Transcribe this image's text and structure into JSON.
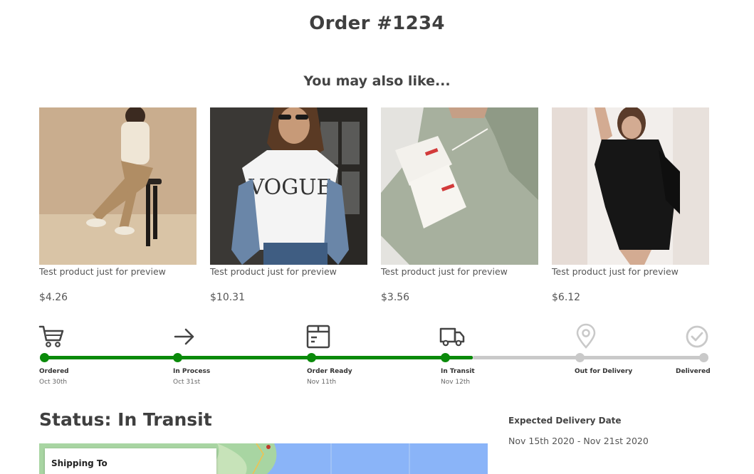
{
  "order": {
    "title": "Order #1234"
  },
  "recommendations": {
    "title": "You may also like...",
    "products": [
      {
        "name": "Test product just for preview",
        "price": "$4.26"
      },
      {
        "name": "Test product just for preview",
        "price": "$10.31"
      },
      {
        "name": "Test product just for preview",
        "price": "$3.56"
      },
      {
        "name": "Test product just for preview",
        "price": "$6.12"
      }
    ]
  },
  "tracking": {
    "progress_color": "#0a8a0a",
    "pending_color": "#c9c9c9",
    "steps": [
      {
        "label": "Ordered",
        "date": "Oct 30th",
        "icon": "cart-icon",
        "done": true
      },
      {
        "label": "In Process",
        "date": "Oct 31st",
        "icon": "arrow-right-icon",
        "done": true
      },
      {
        "label": "Order Ready",
        "date": "Nov 11th",
        "icon": "package-icon",
        "done": true
      },
      {
        "label": "In Transit",
        "date": "Nov 12th",
        "icon": "truck-icon",
        "done": true
      },
      {
        "label": "Out for Delivery",
        "date": "",
        "icon": "map-pin-icon",
        "done": false
      },
      {
        "label": "Delivered",
        "date": "",
        "icon": "check-circle-icon",
        "done": false
      }
    ]
  },
  "status": {
    "text": "Status: In Transit"
  },
  "delivery": {
    "label": "Expected Delivery Date",
    "range": "Nov 15th 2020 - Nov 21st 2020"
  },
  "shipping": {
    "title": "Shipping To"
  }
}
